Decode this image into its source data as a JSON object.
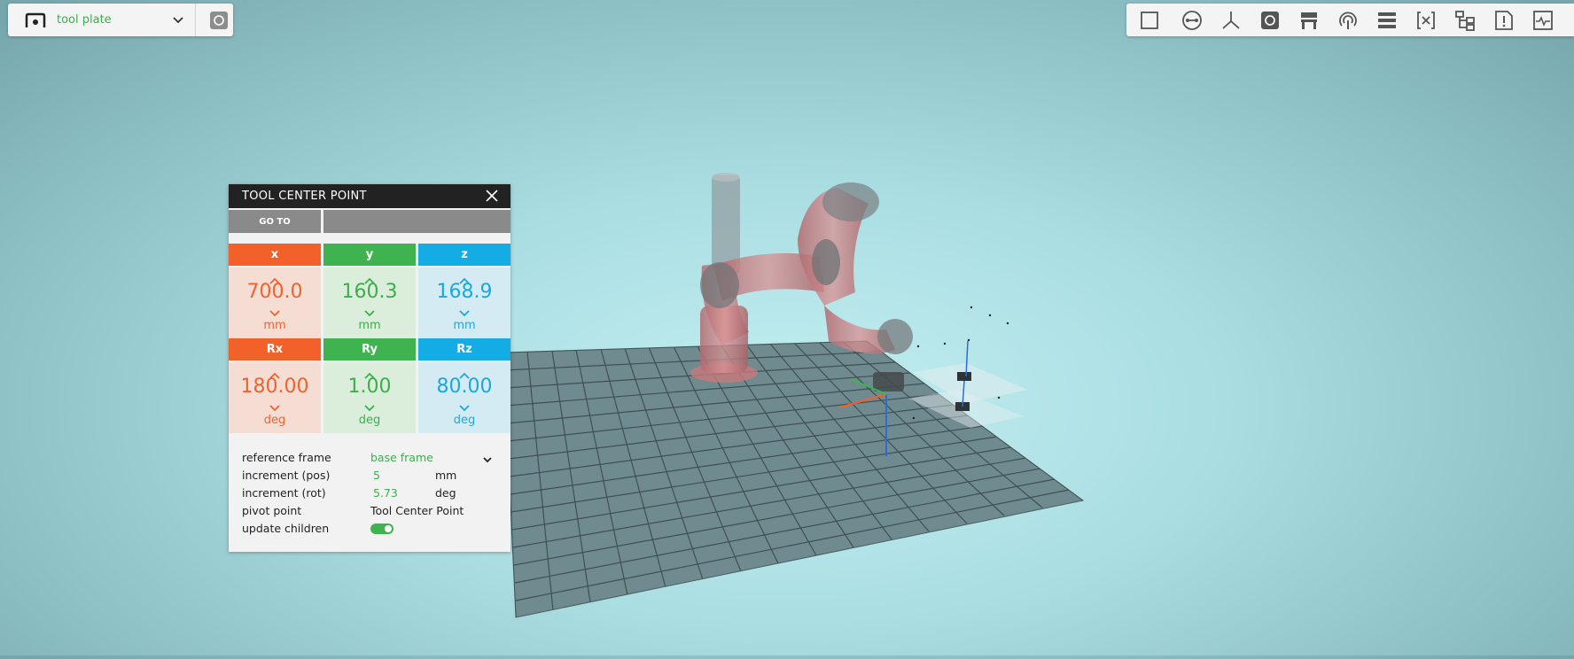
{
  "selector": {
    "label": "tool plate",
    "icon": "object-icon",
    "camera_icon": "camera-icon"
  },
  "toolbar": {
    "icons": [
      "square-view-icon",
      "measure-icon",
      "axes-icon",
      "camera-icon",
      "printer-icon",
      "signal-icon",
      "list-icon",
      "variable-icon",
      "tree-icon",
      "alert-icon",
      "monitor-icon"
    ]
  },
  "panel": {
    "title": "TOOL CENTER POINT",
    "goto_label": "GO TO",
    "coords": [
      {
        "label": "x",
        "value": "700.0",
        "unit": "mm"
      },
      {
        "label": "y",
        "value": "160.3",
        "unit": "mm"
      },
      {
        "label": "z",
        "value": "168.9",
        "unit": "mm"
      },
      {
        "label": "Rx",
        "value": "180.00",
        "unit": "deg"
      },
      {
        "label": "Ry",
        "value": "1.00",
        "unit": "deg"
      },
      {
        "label": "Rz",
        "value": "80.00",
        "unit": "deg"
      }
    ],
    "settings": {
      "reference_frame_label": "reference frame",
      "reference_frame_value": "base frame",
      "increment_pos_label": "increment (pos)",
      "increment_pos_value": "5",
      "increment_pos_unit": "mm",
      "increment_rot_label": "increment (rot)",
      "increment_rot_value": "5.73",
      "increment_rot_unit": "deg",
      "pivot_label": "pivot point",
      "pivot_value": "Tool Center Point",
      "update_children_label": "update children",
      "update_children_on": true
    }
  },
  "colors": {
    "x_axis": "#f2612a",
    "y_axis": "#3fb34f",
    "z_axis": "#13ace5",
    "accent": "#3caf4d"
  }
}
